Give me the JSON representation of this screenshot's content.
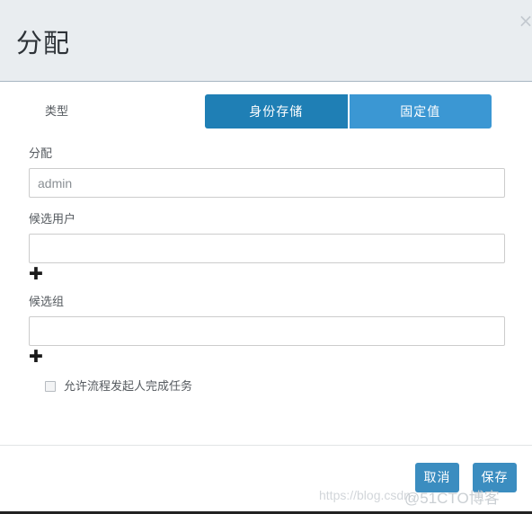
{
  "dialog": {
    "title": "分配",
    "close_icon": "×"
  },
  "type_row": {
    "label": "类型",
    "options": [
      {
        "label": "身份存储",
        "active": true
      },
      {
        "label": "固定值",
        "active": false
      }
    ]
  },
  "fields": {
    "assign": {
      "label": "分配",
      "value": "admin",
      "placeholder": "admin"
    },
    "candidate_users": {
      "label": "候选用户",
      "value": "",
      "placeholder": "",
      "add_icon": "✚"
    },
    "candidate_groups": {
      "label": "候选组",
      "value": "",
      "placeholder": "",
      "add_icon": "✚"
    }
  },
  "checkbox": {
    "label": "允许流程发起人完成任务",
    "checked": false
  },
  "footer": {
    "cancel_label": "取消",
    "save_label": "保存"
  },
  "watermarks": {
    "url": "https://blog.csdn.",
    "brand": "@51CTO博客"
  },
  "colors": {
    "header_bg": "#e9edf0",
    "primary_active": "#1f7fb5",
    "primary_inactive": "#3b97d3",
    "footer_button": "#3b8dc0",
    "border": "#cccccc",
    "text": "#555a5f"
  }
}
